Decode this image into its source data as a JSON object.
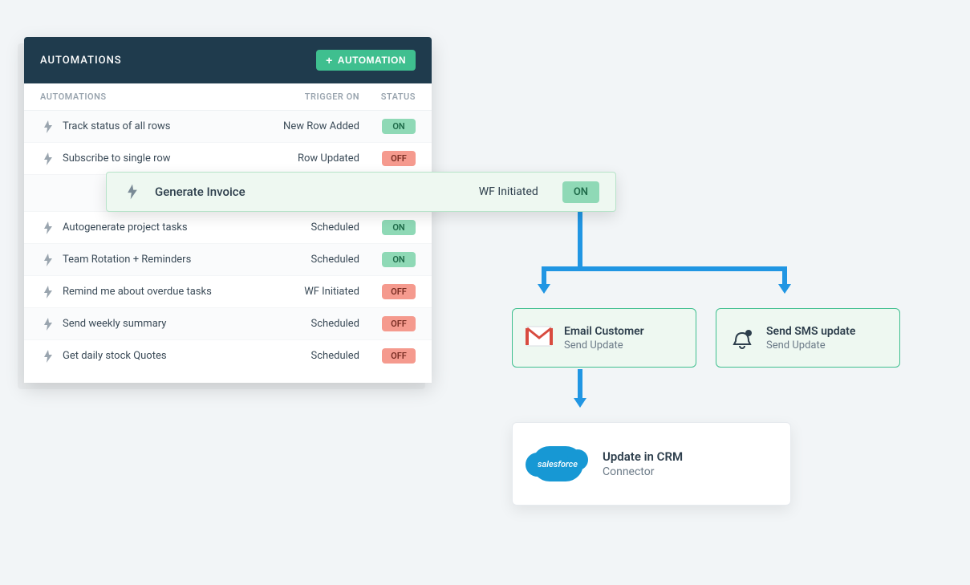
{
  "panel": {
    "title": "AUTOMATIONS",
    "addButton": "AUTOMATION",
    "columns": {
      "name": "AUTOMATIONS",
      "trigger": "TRIGGER ON",
      "status": "STATUS"
    },
    "rows": [
      {
        "name": "Track status of all rows",
        "trigger": "New Row Added",
        "status": "ON"
      },
      {
        "name": "Subscribe to single row",
        "trigger": "Row Updated",
        "status": "OFF"
      },
      {
        "name": "Autogenerate project tasks",
        "trigger": "Scheduled",
        "status": "ON"
      },
      {
        "name": "Team Rotation + Reminders",
        "trigger": "Scheduled",
        "status": "ON"
      },
      {
        "name": "Remind me about overdue tasks",
        "trigger": "WF Initiated",
        "status": "OFF"
      },
      {
        "name": "Send weekly summary",
        "trigger": "Scheduled",
        "status": "OFF"
      },
      {
        "name": "Get daily stock Quotes",
        "trigger": "Scheduled",
        "status": "OFF"
      }
    ]
  },
  "expanded": {
    "name": "Generate Invoice",
    "trigger": "WF Initiated",
    "status": "ON"
  },
  "flow": {
    "email": {
      "title": "Email Customer",
      "subtitle": "Send Update"
    },
    "sms": {
      "title": "Send SMS update",
      "subtitle": "Send Update"
    },
    "crm": {
      "title": "Update in CRM",
      "subtitle": "Connector",
      "vendor": "salesforce"
    }
  },
  "colors": {
    "headerBg": "#1f3b4d",
    "green": "#3fbf8f",
    "blue": "#2196e3",
    "onBadge": "#8fd9b6",
    "offBadge": "#f59a8e"
  }
}
